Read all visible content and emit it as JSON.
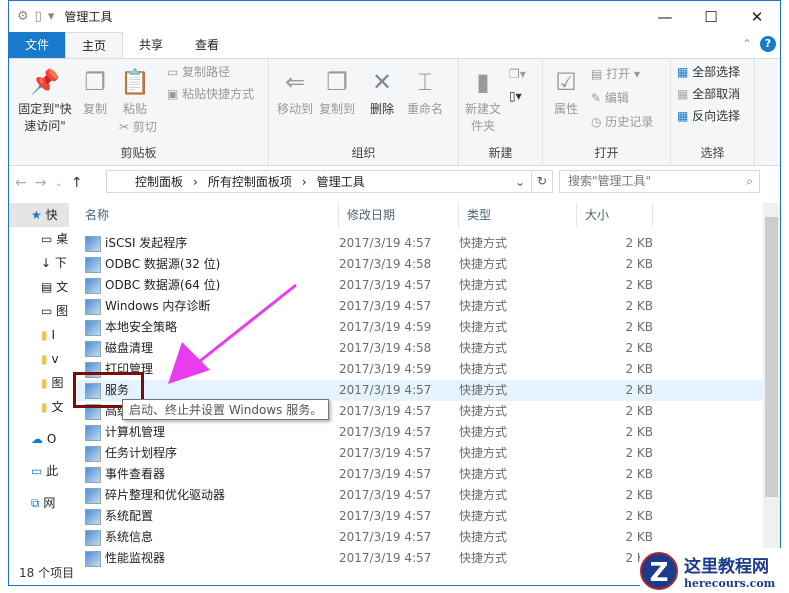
{
  "window": {
    "title": "管理工具",
    "minimize": "—",
    "maximize": "☐",
    "close": "✕"
  },
  "tabs": [
    "文件",
    "主页",
    "共享",
    "查看"
  ],
  "ribbon": {
    "clipboard": {
      "label": "剪贴板",
      "pin": "固定到\"快速访问\"",
      "copy": "复制",
      "paste": "粘贴",
      "copy_path": "复制路径",
      "paste_shortcut": "粘贴快捷方式",
      "cut": "剪切"
    },
    "organize": {
      "label": "组织",
      "move_to": "移动到",
      "copy_to": "复制到",
      "delete": "删除",
      "rename": "重命名"
    },
    "new": {
      "label": "新建",
      "new_folder": "新建文件夹"
    },
    "open": {
      "label": "打开",
      "properties": "属性",
      "open": "打开",
      "edit": "编辑",
      "history": "历史记录"
    },
    "select": {
      "label": "选择",
      "select_all": "全部选择",
      "select_none": "全部取消",
      "invert": "反向选择"
    }
  },
  "address": {
    "crumbs": [
      "控制面板",
      "所有控制面板项",
      "管理工具"
    ],
    "search_placeholder": "搜索\"管理工具\""
  },
  "sidebar": [
    "快",
    "桌",
    "下",
    "文",
    "图",
    "I",
    "v",
    "图",
    "文",
    "O",
    "此",
    "网"
  ],
  "columns": [
    "名称",
    "修改日期",
    "类型",
    "大小"
  ],
  "files": [
    {
      "name": "iSCSI 发起程序",
      "date": "2017/3/19 4:57",
      "type": "快捷方式",
      "size": "2 KB"
    },
    {
      "name": "ODBC 数据源(32 位)",
      "date": "2017/3/19 4:58",
      "type": "快捷方式",
      "size": "2 KB"
    },
    {
      "name": "ODBC 数据源(64 位)",
      "date": "2017/3/19 4:57",
      "type": "快捷方式",
      "size": "2 KB"
    },
    {
      "name": "Windows 内存诊断",
      "date": "2017/3/19 4:57",
      "type": "快捷方式",
      "size": "2 KB"
    },
    {
      "name": "本地安全策略",
      "date": "2017/3/19 4:59",
      "type": "快捷方式",
      "size": "2 KB"
    },
    {
      "name": "磁盘清理",
      "date": "2017/3/19 4:58",
      "type": "快捷方式",
      "size": "2 KB"
    },
    {
      "name": "打印管理",
      "date": "2017/3/19 4:59",
      "type": "快捷方式",
      "size": "2 KB"
    },
    {
      "name": "服务",
      "date": "2017/3/19 4:57",
      "type": "快捷方式",
      "size": "2 KB"
    },
    {
      "name": "高级安全 Windows 防火墙",
      "date": "2017/3/19 4:57",
      "type": "快捷方式",
      "size": "2 KB"
    },
    {
      "name": "计算机管理",
      "date": "2017/3/19 4:57",
      "type": "快捷方式",
      "size": "2 KB"
    },
    {
      "name": "任务计划程序",
      "date": "2017/3/19 4:57",
      "type": "快捷方式",
      "size": "2 KB"
    },
    {
      "name": "事件查看器",
      "date": "2017/3/19 4:57",
      "type": "快捷方式",
      "size": "2 KB"
    },
    {
      "name": "碎片整理和优化驱动器",
      "date": "2017/3/19 4:57",
      "type": "快捷方式",
      "size": "2 KB"
    },
    {
      "name": "系统配置",
      "date": "2017/3/19 4:57",
      "type": "快捷方式",
      "size": "2 KB"
    },
    {
      "name": "系统信息",
      "date": "2017/3/19 4:57",
      "type": "快捷方式",
      "size": "2 KB"
    },
    {
      "name": "性能监视器",
      "date": "2017/3/19 4:57",
      "type": "快捷方式",
      "size": "2 KB"
    }
  ],
  "tooltip": "启动、终止并设置 Windows 服务。",
  "status": "18 个项目",
  "watermark": {
    "title": "这里教程网",
    "url": "herecours.com"
  }
}
